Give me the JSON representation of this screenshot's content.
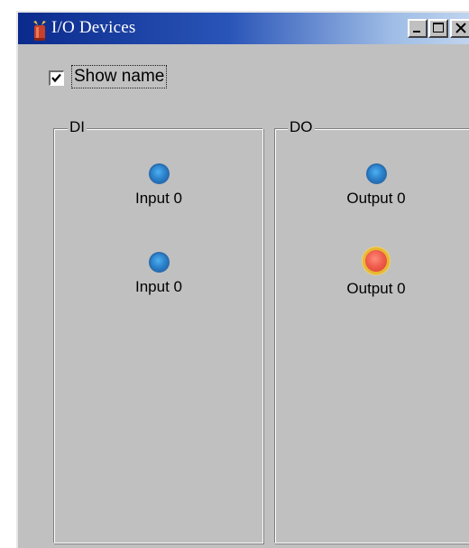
{
  "window": {
    "title": "I/O Devices",
    "app_icon": "device-icon",
    "controls": {
      "minimize_icon": "minimize-icon",
      "maximize_icon": "maximize-icon",
      "close_icon": "close-icon"
    }
  },
  "options": {
    "show_name_label": "Show name",
    "show_name_checked": true
  },
  "groups": {
    "di": {
      "legend": "DI",
      "items": [
        {
          "label": "Input 0",
          "state": "off"
        },
        {
          "label": "Input 0",
          "state": "off"
        }
      ]
    },
    "do": {
      "legend": "DO",
      "items": [
        {
          "label": "Output 0",
          "state": "off"
        },
        {
          "label": "Output 0",
          "state": "on"
        }
      ]
    }
  },
  "colors": {
    "titlebar_start": "#0a2a8c",
    "titlebar_end": "#c7d9f0",
    "window_bg": "#c0c0c0",
    "led_off": "#2e86cf",
    "led_on": "#ee5a4a",
    "led_on_ring": "#e8b830"
  }
}
